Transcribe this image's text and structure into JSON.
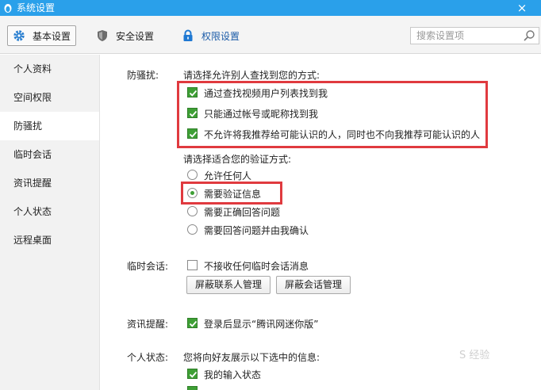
{
  "window": {
    "title": "系统设置",
    "close_glyph": "×",
    "app_icon": "penguin-icon"
  },
  "toolbar": {
    "tabs": [
      {
        "label": "基本设置",
        "icon": "gear-icon",
        "active": true
      },
      {
        "label": "安全设置",
        "icon": "shield-icon",
        "active": false
      },
      {
        "label": "权限设置",
        "icon": "lock-icon",
        "active": false
      }
    ],
    "search": {
      "placeholder": "搜索设置项",
      "value": "",
      "icon": "search-icon"
    }
  },
  "sidebar": {
    "items": [
      {
        "label": "个人资料"
      },
      {
        "label": "空间权限"
      },
      {
        "label": "防骚扰",
        "active": true
      },
      {
        "label": "临时会话"
      },
      {
        "label": "资讯提醒"
      },
      {
        "label": "个人状态"
      },
      {
        "label": "远程桌面"
      }
    ]
  },
  "anti_harass": {
    "label": "防骚扰:",
    "find_prompt": "请选择允许别人查找到您的方式:",
    "find_options": [
      {
        "label": "通过查找视频用户列表找到我",
        "checked": true
      },
      {
        "label": "只能通过帐号或昵称找到我",
        "checked": true
      },
      {
        "label": "不允许将我推荐给可能认识的人，同时也不向我推荐可能认识的人",
        "checked": true
      }
    ],
    "verify_prompt": "请选择适合您的验证方式:",
    "verify_options": [
      {
        "label": "允许任何人",
        "selected": false
      },
      {
        "label": "需要验证信息",
        "selected": true
      },
      {
        "label": "需要正确回答问题",
        "selected": false
      },
      {
        "label": "需要回答问题并由我确认",
        "selected": false
      }
    ]
  },
  "temp_session": {
    "label": "临时会话:",
    "option": {
      "label": "不接收任何临时会话消息",
      "checked": false
    },
    "buttons": [
      "屏蔽联系人管理",
      "屏蔽会话管理"
    ]
  },
  "news": {
    "label": "资讯提醒:",
    "option": {
      "label": "登录后显示“腾讯网迷你版”",
      "checked": true
    }
  },
  "status": {
    "label": "个人状态:",
    "prompt": "您将向好友展示以下选中的信息:",
    "options": [
      {
        "label": "我的输入状态",
        "checked": true
      }
    ]
  },
  "watermark": "S 经验",
  "colors": {
    "titlebar": "#2aa0ea",
    "check_green": "#3e9f35",
    "highlight_red": "#e03a3f",
    "link_blue": "#1c5ca8"
  }
}
